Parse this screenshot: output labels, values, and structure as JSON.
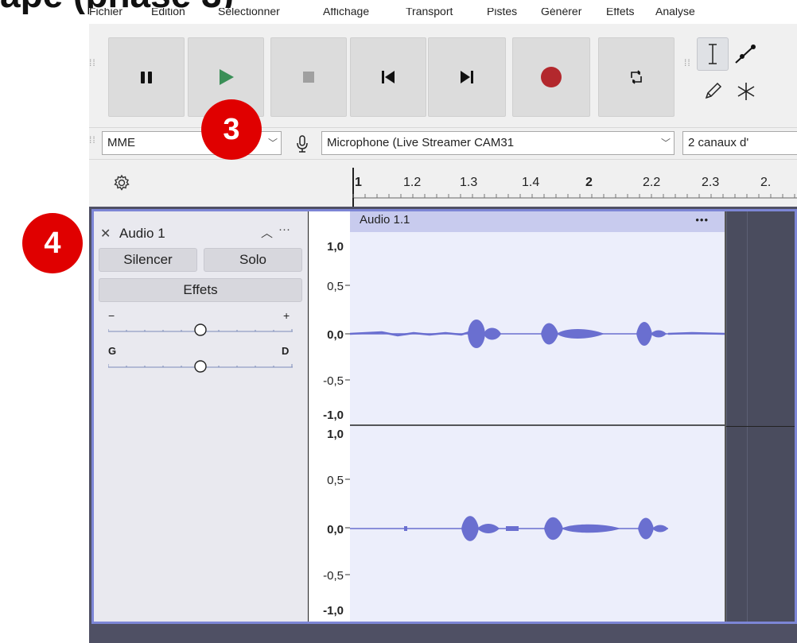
{
  "menu": [
    "Fichier",
    "Édition",
    "Sélectionner",
    "Affichage",
    "Transport",
    "Pistes",
    "Générer",
    "Effets",
    "Analyse"
  ],
  "transport": {
    "buttons": [
      "pause-icon",
      "play-icon",
      "stop-icon",
      "skip-start-icon",
      "skip-end-icon",
      "record-icon",
      "loop-icon"
    ],
    "colors": {
      "play": "#3a8f57",
      "record": "#b3282d",
      "disabled": "#a0a0a0"
    }
  },
  "tools": [
    "select-icon",
    "envelope-icon",
    "draw-icon",
    "multi-icon"
  ],
  "device": {
    "host": "MME",
    "recording_device": "Microphone (Live Streamer CAM31",
    "channels": "2 canaux d'"
  },
  "ruler": {
    "ticks": [
      "1",
      "1.2",
      "1.3",
      "1.4",
      "2",
      "2.2",
      "2.3",
      "2."
    ]
  },
  "track": {
    "name": "Audio 1",
    "mute_label": "Silencer",
    "solo_label": "Solo",
    "effects_label": "Effets",
    "gain_min": "−",
    "gain_max": "+",
    "pan_left": "G",
    "pan_right": "D",
    "clip_name": "Audio 1.1",
    "clip_menu": "•••",
    "scale_labels": [
      "1,0",
      "0,5",
      "0,0",
      "-0,5",
      "-1,0"
    ],
    "accent": "#7d86d6",
    "wave_color": "#6a6fd0"
  },
  "annotations": {
    "badge_3": "3",
    "badge_4": "4"
  },
  "header_fragment": "ape (phase 3)"
}
